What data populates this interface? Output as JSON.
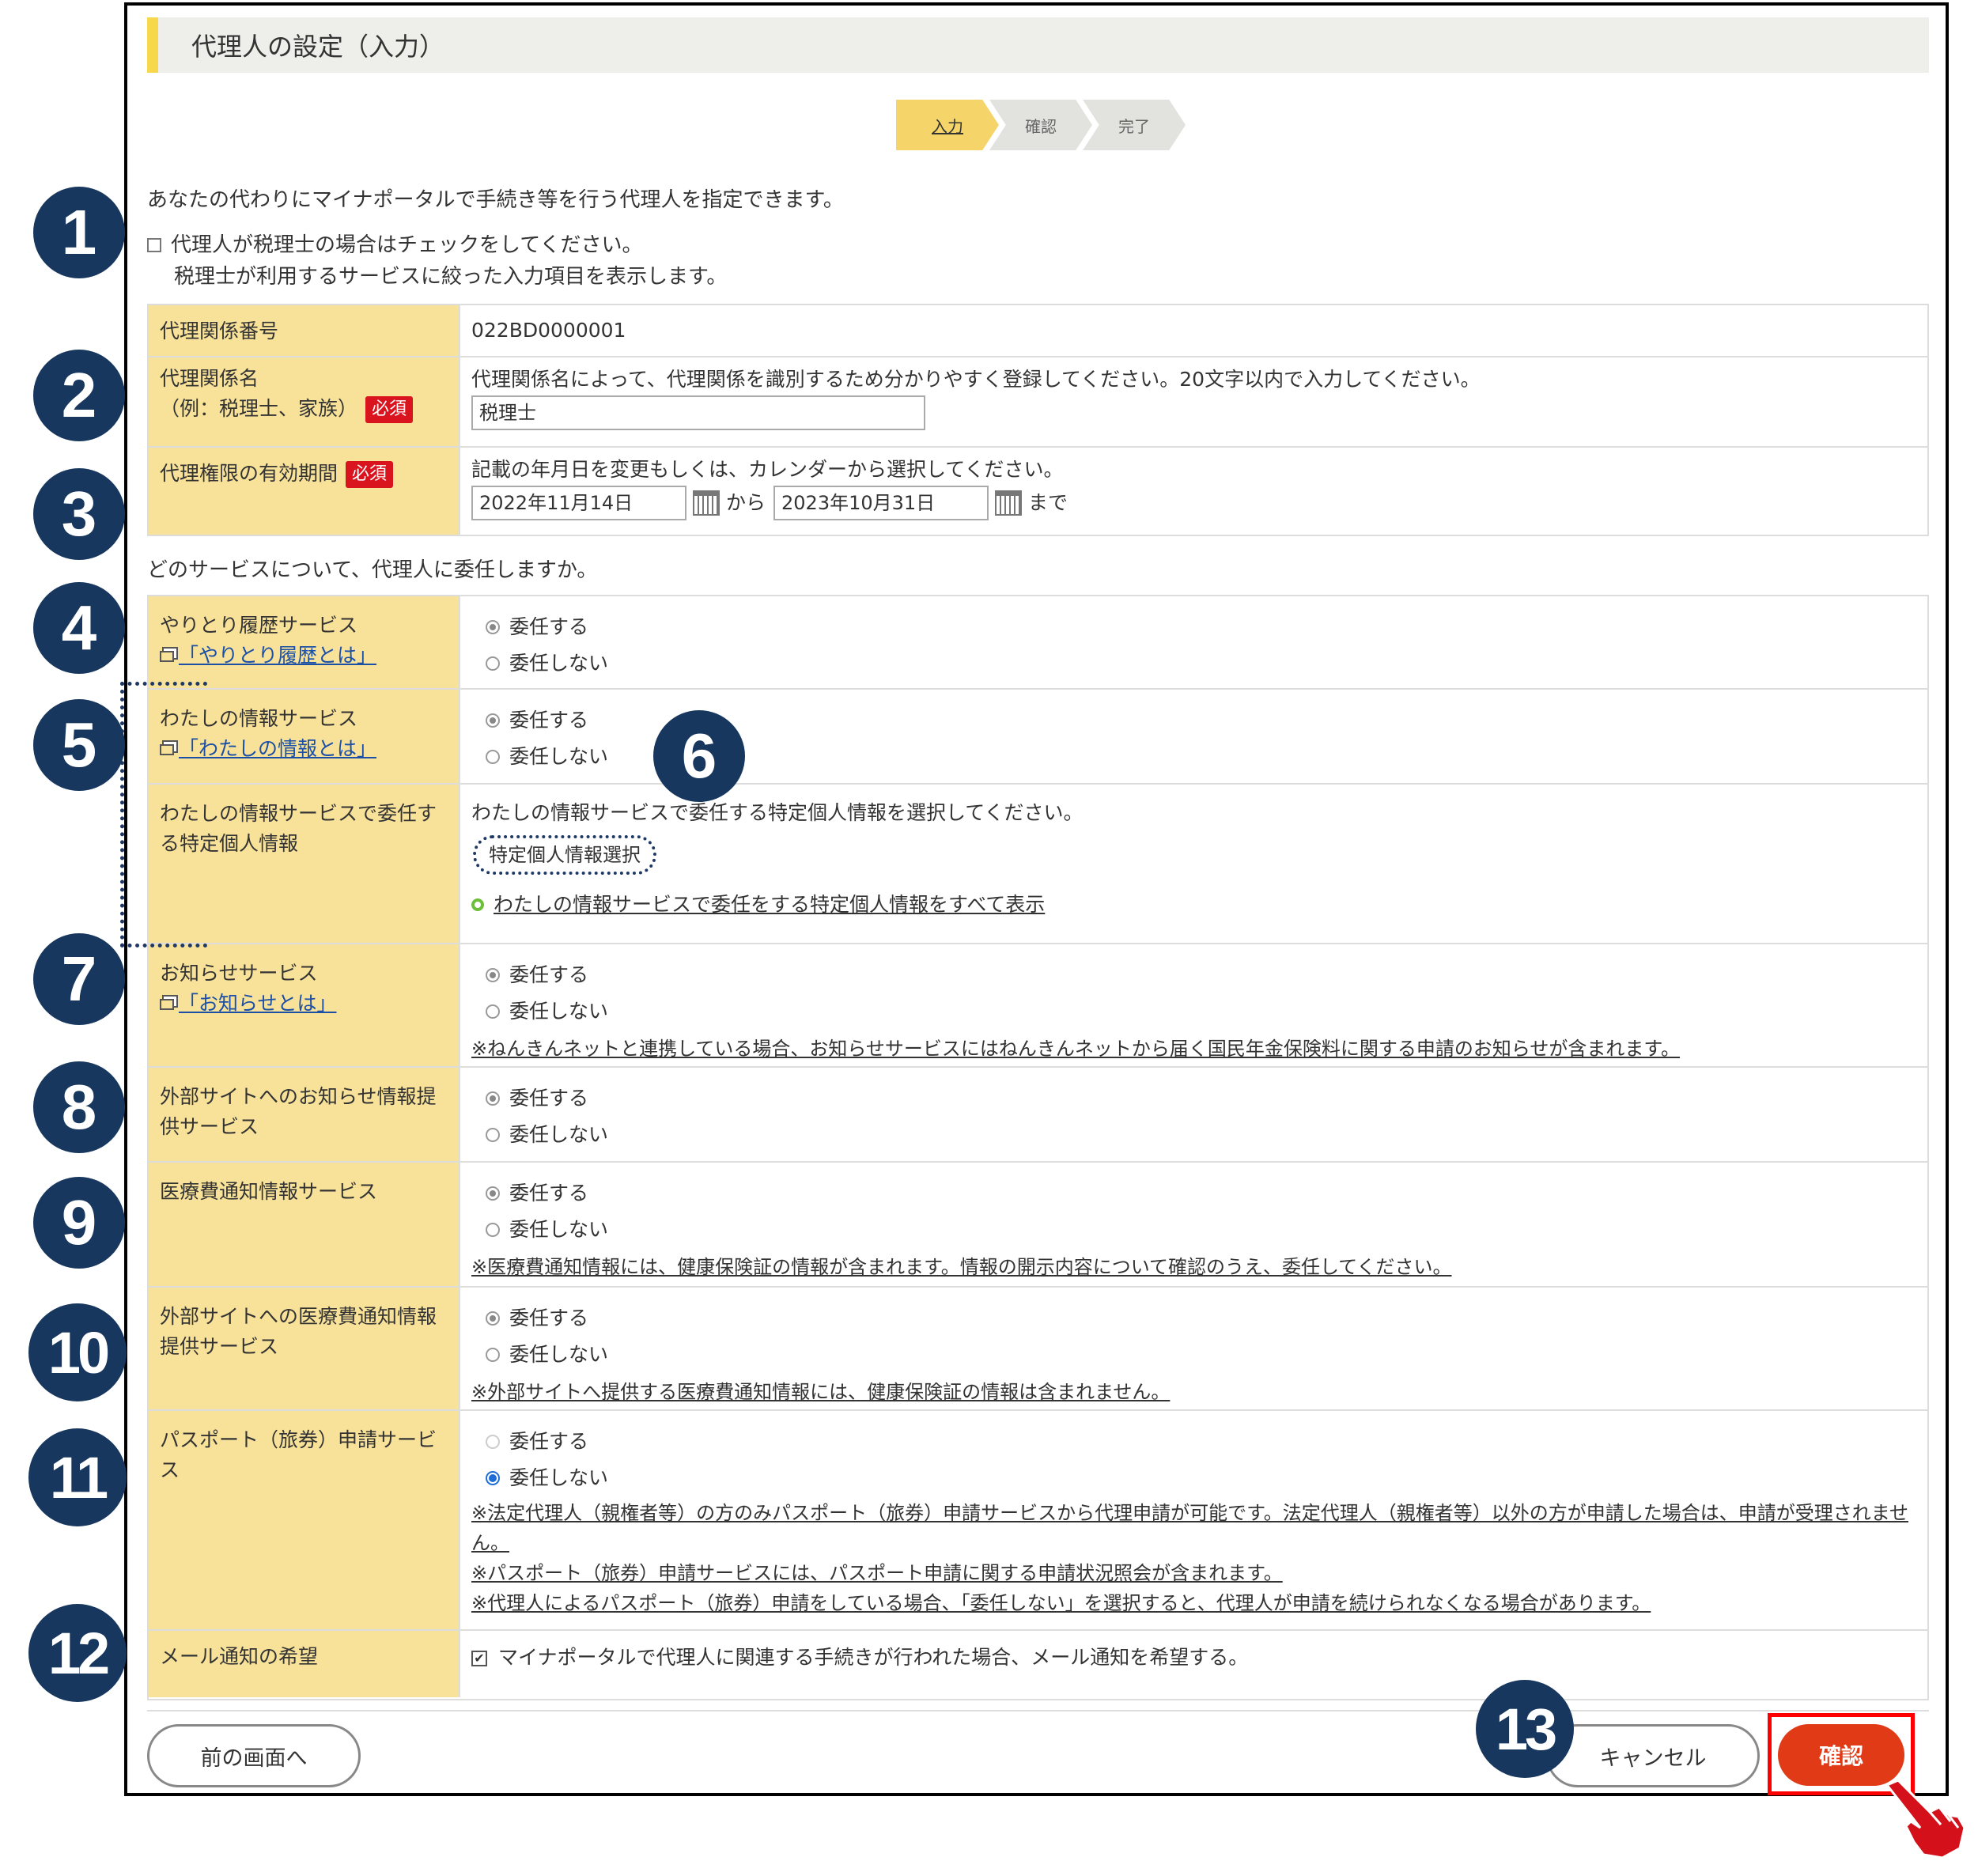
{
  "header": {
    "title": "代理人の設定（入力）"
  },
  "steps": [
    {
      "label": "入力",
      "active": true
    },
    {
      "label": "確認",
      "active": false
    },
    {
      "label": "完了",
      "active": false
    }
  ],
  "intro": "あなたの代わりにマイナポータルで手続き等を行う代理人を指定できます。",
  "tax_check": {
    "line1": "代理人が税理士の場合はチェックをしてください。",
    "line2": "税理士が利用するサービスに絞った入力項目を表示します。",
    "checked": false
  },
  "required_label": "必須",
  "rel_number": {
    "label": "代理関係番号",
    "value": "022BD0000001"
  },
  "rel_name": {
    "label_line1": "代理関係名",
    "label_line2": "（例：税理士、家族）",
    "help": "代理関係名によって、代理関係を識別するため分かりやすく登録してください。20文字以内で入力してください。",
    "value": "税理士"
  },
  "period": {
    "label": "代理権限の有効期間",
    "help": "記載の年月日を変更もしくは、カレンダーから選択してください。",
    "start": "2022年11月14日",
    "from_label": "から",
    "end": "2023年10月31日",
    "until_label": "まで"
  },
  "services_question": "どのサービスについて、代理人に委任しますか。",
  "radio_labels": {
    "yes": "委任する",
    "no": "委任しない"
  },
  "services": {
    "history": {
      "label": "やりとり履歴サービス",
      "link": "「やりとり履歴とは」"
    },
    "myinfo": {
      "label": "わたしの情報サービス",
      "link": "「わたしの情報とは」"
    },
    "specific": {
      "label": "わたしの情報サービスで委任する特定個人情報",
      "help": "わたしの情報サービスで委任する特定個人情報を選択してください。",
      "button": "特定個人情報選択",
      "show_all": "わたしの情報サービスで委任をする特定個人情報をすべて表示"
    },
    "notice": {
      "label": "お知らせサービス",
      "link": "「お知らせとは」",
      "note": "※ねんきんネットと連携している場合、お知らせサービスにはねんきんネットから届く国民年金保険料に関する申請のお知らせが含まれます。"
    },
    "ext_notice": {
      "label": "外部サイトへのお知らせ情報提供サービス"
    },
    "medical": {
      "label": "医療費通知情報サービス",
      "note": "※医療費通知情報には、健康保険証の情報が含まれます。情報の開示内容について確認のうえ、委任してください。"
    },
    "ext_medical": {
      "label": "外部サイトへの医療費通知情報提供サービス",
      "note": "※外部サイトへ提供する医療費通知情報には、健康保険証の情報は含まれません。"
    },
    "passport": {
      "label": "パスポート（旅券）申請サービス",
      "note1": "※法定代理人（親権者等）の方のみパスポート（旅券）申請サービスから代理申請が可能です。法定代理人（親権者等）以外の方が申請した場合は、申請が受理されません。",
      "note2": "※パスポート（旅券）申請サービスには、パスポート申請に関する申請状況照会が含まれます。",
      "note3": "※代理人によるパスポート（旅券）申請をしている場合、「委任しない」を選択すると、代理人が申請を続けられなくなる場合があります。"
    }
  },
  "mail": {
    "label": "メール通知の希望",
    "text": "マイナポータルで代理人に関連する手続きが行われた場合、メール通知を希望する。",
    "checked": true
  },
  "buttons": {
    "prev": "前の画面へ",
    "cancel": "キャンセル",
    "confirm": "確認"
  },
  "badges": [
    "1",
    "2",
    "3",
    "4",
    "5",
    "6",
    "7",
    "8",
    "9",
    "10",
    "11",
    "12",
    "13"
  ],
  "colors": {
    "badge": "#17375e",
    "header_accent": "#f7d84a",
    "th_bg": "#f8e299",
    "confirm": "#e03a17",
    "required": "#d9141e"
  }
}
